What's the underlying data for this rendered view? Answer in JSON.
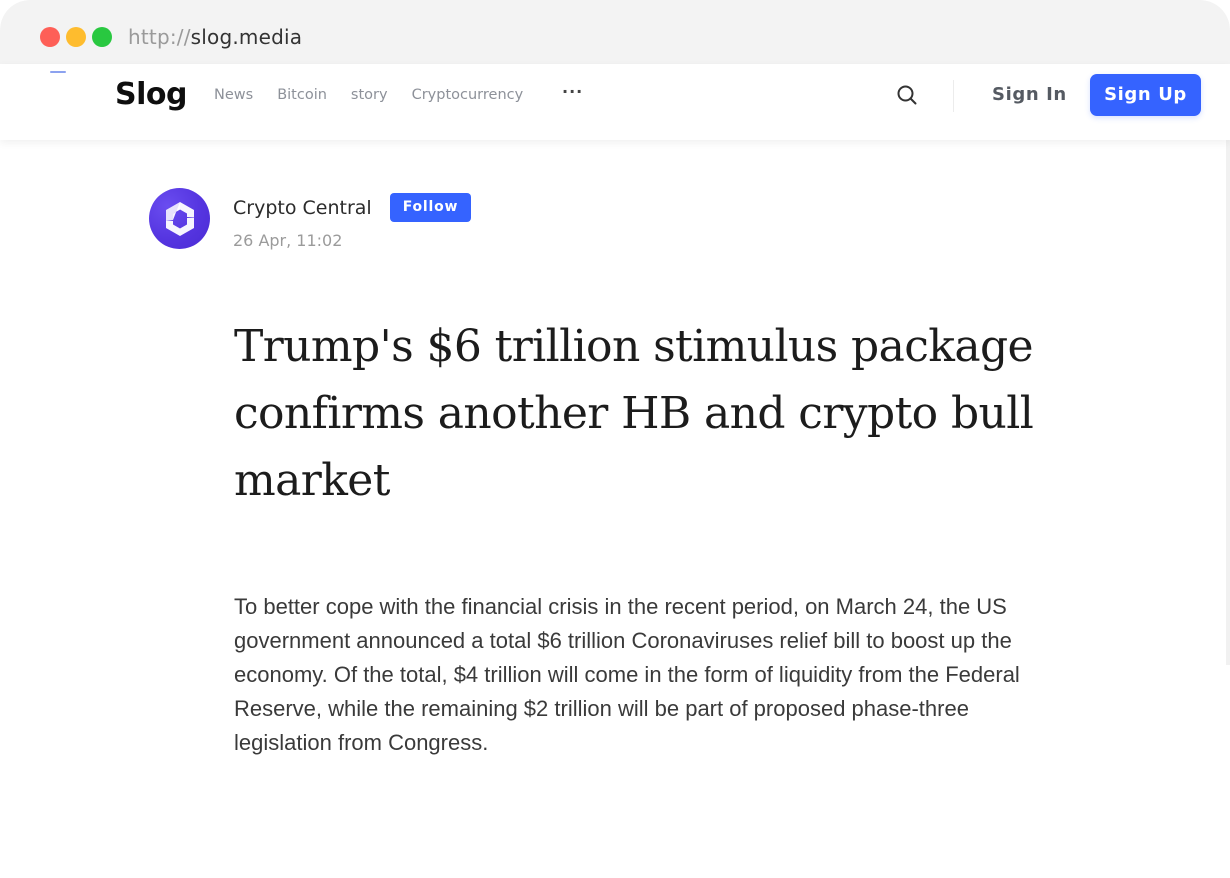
{
  "browser": {
    "url_scheme": "http://",
    "url_host": "slog.media"
  },
  "navbar": {
    "logo": "Slog",
    "links": [
      "News",
      "Bitcoin",
      "story",
      "Cryptocurrency"
    ],
    "more_label": "···",
    "search_icon": "search-icon",
    "sign_in_label": "Sign In",
    "sign_up_label": "Sign Up",
    "accent_color": "#3563ff"
  },
  "author": {
    "name": "Crypto Central",
    "follow_label": "Follow",
    "timestamp": "26 Apr, 11:02",
    "avatar_icon": "crypto-central-logo-icon",
    "avatar_color": "#5535e0"
  },
  "article": {
    "title": "Trump's $6 trillion stimulus package confirms another HB and crypto bull market",
    "body": "To better cope with the financial crisis in the recent period, on March 24, the US government announced a total $6 trillion Coronaviruses relief bill to boost up the economy. Of the total, $4 trillion will come in the form of liquidity from the Federal Reserve, while the remaining $2 trillion will be part of proposed phase-three legislation from Congress."
  }
}
